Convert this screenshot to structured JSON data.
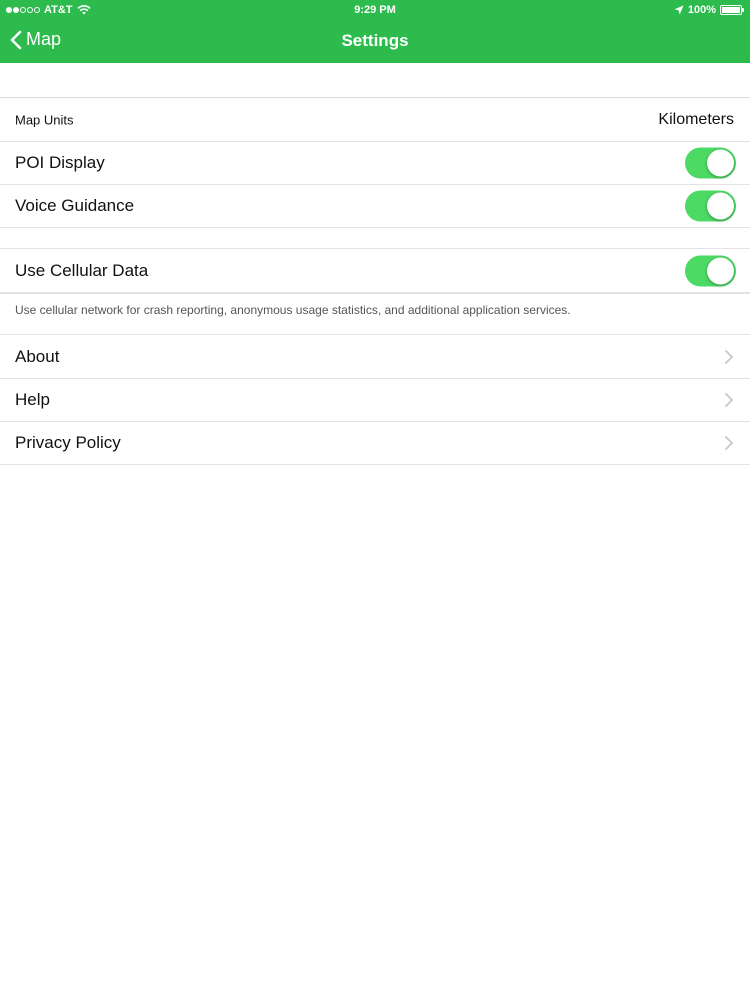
{
  "status_bar": {
    "carrier": "AT&T",
    "time": "9:29 PM",
    "battery": "100%"
  },
  "nav": {
    "back_label": "Map",
    "title": "Settings"
  },
  "settings": {
    "map_units_label": "Map Units",
    "map_units_value": "Kilometers",
    "poi_label": "POI Display",
    "poi_enabled": true,
    "voice_label": "Voice Guidance",
    "voice_enabled": true,
    "cellular_label": "Use Cellular Data",
    "cellular_enabled": true,
    "cellular_note": "Use cellular network for crash reporting, anonymous usage statistics, and additional application services."
  },
  "links": {
    "about": "About",
    "help": "Help",
    "privacy": "Privacy Policy"
  },
  "colors": {
    "nav_green": "#2dbb4d",
    "toggle_green": "#4cd964",
    "text": "#111111"
  },
  "icons": [
    "signal-dots-icon",
    "wifi-icon",
    "location-arrow-icon",
    "battery-icon",
    "back-chevron-icon",
    "chevron-right-icon"
  ]
}
